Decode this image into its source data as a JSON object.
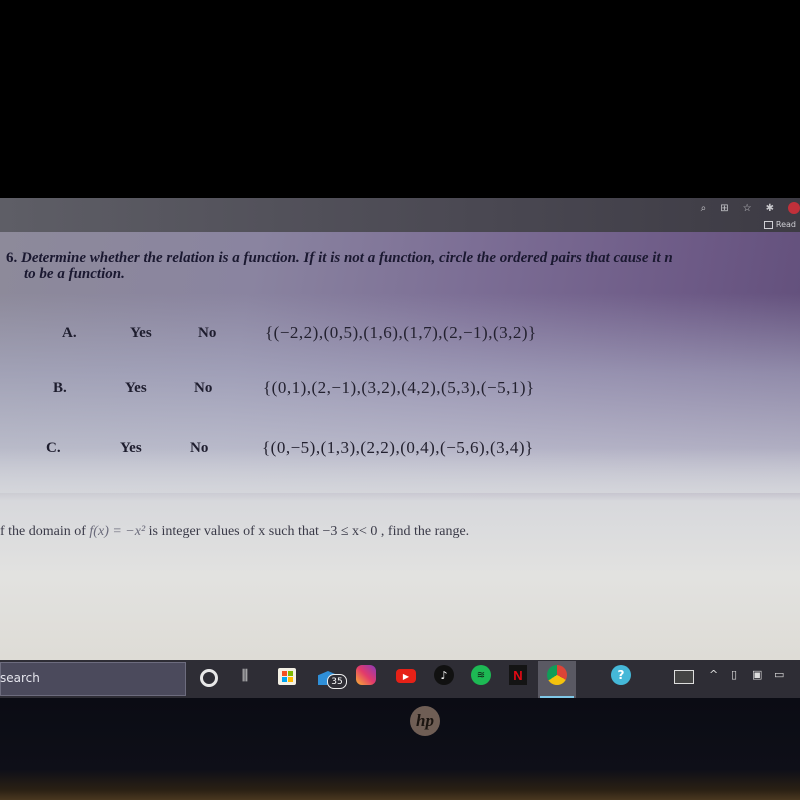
{
  "browser": {
    "icons": [
      "zoom-icon",
      "extensions-icon",
      "bookmark-star-icon",
      "puzzle-icon",
      "profile-avatar"
    ],
    "reading_list_label": "Read"
  },
  "worksheet": {
    "question6": {
      "number": "6.",
      "prompt_line1": "Determine whether the relation is a function.  If it is not a function, circle the ordered pairs that cause it n",
      "prompt_line2": "to be a function.",
      "items": [
        {
          "letter": "A.",
          "yes": "Yes",
          "no": "No",
          "set": "{(−2,2),(0,5),(1,6),(1,7),(2,−1),(3,2)}"
        },
        {
          "letter": "B.",
          "yes": "Yes",
          "no": "No",
          "set": "{(0,1),(2,−1),(3,2),(4,2),(5,3),(−5,1)}"
        },
        {
          "letter": "C.",
          "yes": "Yes",
          "no": "No",
          "set": "{(0,−5),(1,3),(2,2),(0,4),(−5,6),(3,4)}"
        }
      ]
    },
    "question7": {
      "text_before": "f the domain of ",
      "function": "f(x) = −x²",
      "text_after": " is integer values of x such that  −3 ≤ x< 0 , find the range."
    }
  },
  "taskbar": {
    "search_label": "search",
    "mail_badge": "35",
    "youtube_glyph": "▶",
    "tiktok_glyph": "♪",
    "spotify_glyph": "≋",
    "netflix_glyph": "N",
    "help_glyph": "?",
    "tray_chevron": "^",
    "task_view_glyph": "⫼"
  },
  "hardware": {
    "brand_logo": "hp"
  }
}
